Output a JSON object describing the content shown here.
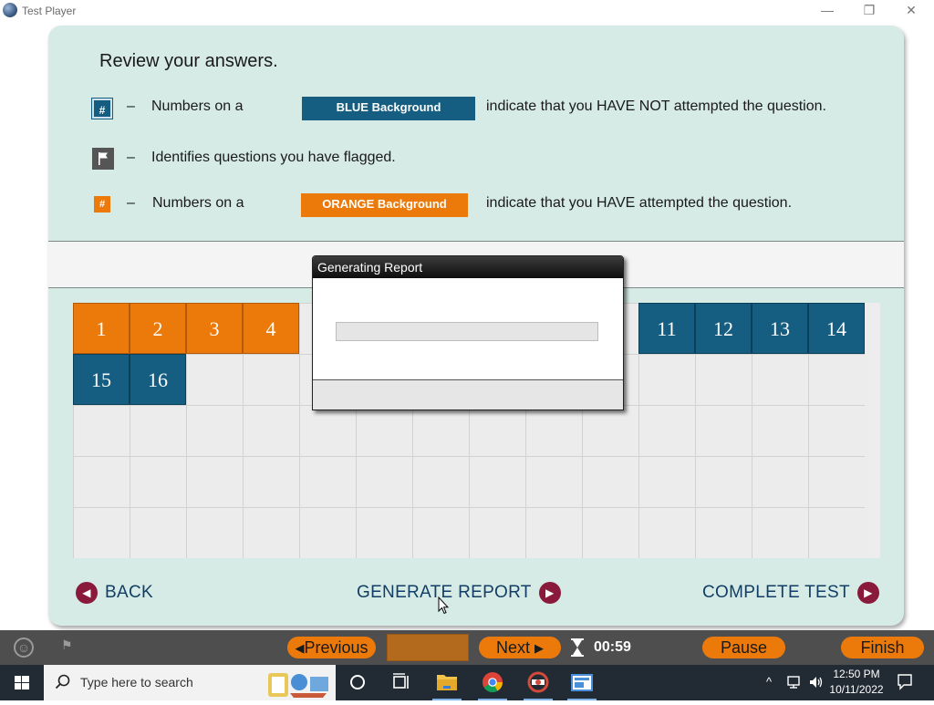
{
  "window": {
    "title": "Test Player",
    "minimize": "—",
    "maximize": "❐",
    "close": "✕"
  },
  "review": {
    "title": "Review your answers.",
    "legend": {
      "blue": {
        "marker": "#",
        "dash": "–",
        "prefix": "Numbers on a",
        "chip": "BLUE Background",
        "suffix": "indicate that you HAVE NOT attempted the question."
      },
      "flag": {
        "dash": "–",
        "text": "Identifies questions you have flagged."
      },
      "orange": {
        "marker": "#",
        "dash": "–",
        "prefix": "Numbers on a",
        "chip": "ORANGE Background",
        "suffix": "indicate that you HAVE attempted the question."
      }
    }
  },
  "questions": [
    {
      "number": "1",
      "status": "attempted"
    },
    {
      "number": "2",
      "status": "attempted"
    },
    {
      "number": "3",
      "status": "attempted"
    },
    {
      "number": "4",
      "status": "attempted"
    },
    {
      "number": "11",
      "status": "not-attempted"
    },
    {
      "number": "12",
      "status": "not-attempted"
    },
    {
      "number": "13",
      "status": "not-attempted"
    },
    {
      "number": "14",
      "status": "not-attempted"
    },
    {
      "number": "15",
      "status": "not-attempted"
    },
    {
      "number": "16",
      "status": "not-attempted"
    }
  ],
  "nav": {
    "back": "BACK",
    "generate_report": "GENERATE REPORT",
    "complete_test": "COMPLETE TEST"
  },
  "dialog": {
    "title": "Generating Report",
    "progress": 0
  },
  "toolbar": {
    "previous": "Previous",
    "next": "Next",
    "timer": "00:59",
    "pause": "Pause",
    "finish": "Finish"
  },
  "taskbar": {
    "search_placeholder": "Type here to search",
    "time": "12:50 PM",
    "date": "10/11/2022"
  },
  "colors": {
    "blue": "#155e82",
    "orange": "#ec7a0b",
    "panel": "#d6ebe6",
    "nav_text": "#123e66",
    "nav_circle": "#8a1a3c"
  }
}
